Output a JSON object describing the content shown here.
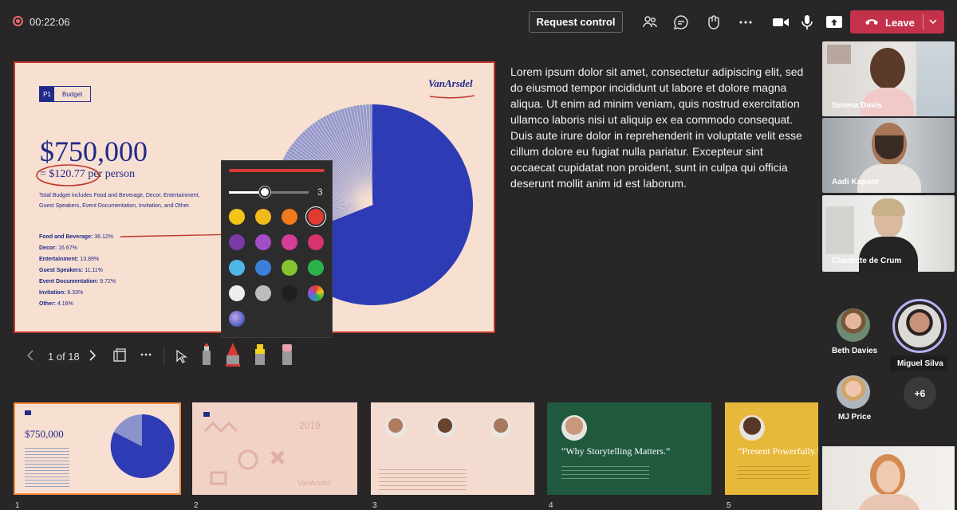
{
  "top_bar": {
    "timer": "00:22:06",
    "request_control_label": "Request control",
    "leave_label": "Leave",
    "leave_color": "#c4314b"
  },
  "slide": {
    "tag_number": "P1",
    "tag_label": "Budget",
    "brand": "VanArsdel",
    "headline": "$750,000",
    "per_person": "= $120.77 per person",
    "description": "Total Budget includes Food and Beverage, Decor, Entertainment, Guest Speakers, Event Documentation, Invitation, and Other.",
    "categories": [
      {
        "label": "Food and Beverage:",
        "value": "36.12%"
      },
      {
        "label": "Decor:",
        "value": "16.67%"
      },
      {
        "label": "Entertainment:",
        "value": "13.89%"
      },
      {
        "label": "Guest Speakers:",
        "value": "11.11%"
      },
      {
        "label": "Event Documentation:",
        "value": "9.72%"
      },
      {
        "label": "Invitation:",
        "value": "8.33%"
      },
      {
        "label": "Other:",
        "value": "4.16%"
      }
    ]
  },
  "pen_palette": {
    "stroke_size": "3",
    "colors": [
      "#f2c418",
      "#f2b91a",
      "#f07a1c",
      "#e03a31",
      "#7a3aa8",
      "#a24ec6",
      "#d63d98",
      "#d6336f",
      "#4fb6e8",
      "#3d7fd9",
      "#84c431",
      "#2bb34a",
      "#eeeeee",
      "#bdbdbd",
      "#1f1f1f",
      "rainbow",
      "galaxy"
    ],
    "selected_color": "#e03a31"
  },
  "notes": "Lorem ipsum dolor sit amet, consectetur adipiscing elit, sed do eiusmod tempor incididunt ut labore et dolore magna aliqua. Ut enim ad minim veniam, quis nostrud exercitation ullamco laboris nisi ut aliquip ex ea commodo consequat. Duis aute irure dolor in reprehenderit in voluptate velit esse cillum dolore eu fugiat nulla pariatur. Excepteur sint occaecat cupidatat non proident, sunt in culpa qui officia deserunt mollit anim id est laborum.",
  "slide_controls": {
    "page_indicator": "1 of 18"
  },
  "participants": {
    "videos": [
      {
        "name": "Serena Davis"
      },
      {
        "name": "Aadi Kapoor"
      },
      {
        "name": "Charlotte de Crum"
      }
    ],
    "avatars": [
      {
        "name": "Beth Davies"
      },
      {
        "name": "Miguel Silva"
      },
      {
        "name": "MJ Price"
      }
    ],
    "more_count": "+6"
  },
  "thumbnails": [
    {
      "number": "1",
      "headline": "$750,000"
    },
    {
      "number": "2",
      "year": "2019",
      "brand": "VanArsdel"
    },
    {
      "number": "3"
    },
    {
      "number": "4",
      "title": "“Why Storytelling Matters.”"
    },
    {
      "number": "5",
      "title": "“Present Powerfully.”"
    }
  ]
}
